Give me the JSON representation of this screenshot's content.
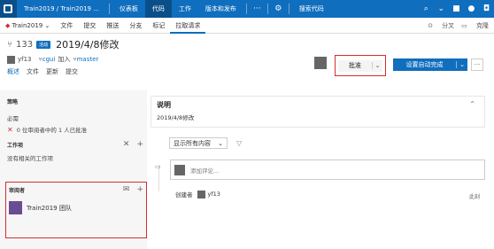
{
  "topbar": {
    "breadcrumb": "Train2019 / Train2019 ...",
    "items": [
      "仪表板",
      "代码",
      "工作",
      "版本和发布"
    ],
    "active": "代码",
    "search_placeholder": "搜索代码"
  },
  "subnav": {
    "repo": "Train2019",
    "items": [
      "文件",
      "提交",
      "推送",
      "分支",
      "标记",
      "拉取请求"
    ],
    "right": [
      "分叉",
      "克隆"
    ]
  },
  "pr": {
    "id": "133",
    "status_badge": "活动",
    "title": "2019/4/8修改",
    "author": "yf13",
    "source_branch": "cgui",
    "merge_verb": "加入",
    "target_branch": "master",
    "tabs": [
      "概述",
      "文件",
      "更新",
      "提交"
    ]
  },
  "actions": {
    "approve_label": "批准",
    "complete_label": "设置自动完成",
    "more_label": "···"
  },
  "policy": {
    "heading": "策略",
    "sub": "必需",
    "line": "0 位审阅者中的 1 人已批准"
  },
  "work_items": {
    "heading": "工作项",
    "empty": "没有相关的工作项"
  },
  "reviewers": {
    "heading": "审阅者",
    "items": [
      {
        "name": "Train2019 团队"
      }
    ]
  },
  "description": {
    "title": "说明",
    "text": "2019/4/8修改"
  },
  "filter": {
    "label": "显示所有内容"
  },
  "comment": {
    "placeholder": "添加评论..."
  },
  "activity": {
    "created_label": "创建者",
    "created_user": "yf13",
    "time": "此刻"
  },
  "colors": {
    "accent": "#106ebe",
    "highlight": "#d32f2f"
  }
}
